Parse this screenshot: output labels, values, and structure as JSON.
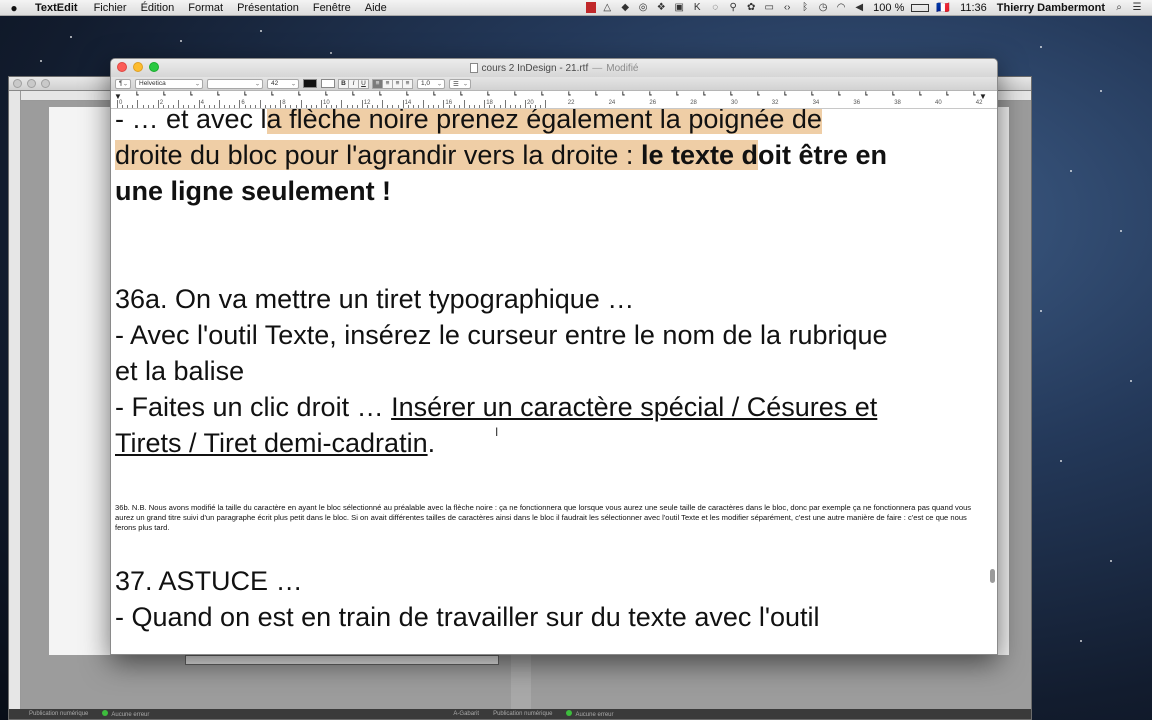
{
  "menubar": {
    "apple": "",
    "app_name": "TextEdit",
    "menus": [
      "Fichier",
      "Édition",
      "Format",
      "Présentation",
      "Fenêtre",
      "Aide"
    ],
    "battery": "100 %",
    "time": "11:36",
    "user": "Thierry Dambermont",
    "flag": "🇫🇷"
  },
  "window": {
    "title": "cours 2 InDesign - 21.rtf",
    "separator": "—",
    "status": "Modifié"
  },
  "toolbar": {
    "paragraph_style": "¶",
    "font_family": "Helvetica",
    "font_style": "",
    "font_size": "42",
    "bold_label": "B",
    "italic_label": "I",
    "underline_label": "U",
    "line_spacing": "1,0",
    "list_label": "☰"
  },
  "ruler": {
    "labels": [
      "0",
      "2",
      "4",
      "6",
      "8",
      "10",
      "12",
      "14",
      "16",
      "18",
      "20",
      "22",
      "24",
      "26",
      "28",
      "30",
      "32",
      "34",
      "36",
      "38",
      "40",
      "42"
    ]
  },
  "document": {
    "line1_a": "- … et avec l",
    "line1_b": "a flèche noire prenez également la poignée de",
    "line2_a": "droite du bloc pour l'agrandir vers la droite : ",
    "line2_b": "le texte d",
    "line2_c": "oit être en",
    "line3": "une ligne seulement !",
    "line4": "36a. On va mettre un tiret typographique …",
    "line5": "- Avec l'outil Texte, insérez le curseur entre le nom de la rubrique",
    "line6": "et la balise",
    "line7_a": "- Faites un clic droit … ",
    "line7_b": "Insérer un caractère spécial / Césures et",
    "line8_a": "Tirets / Tiret demi-cadratin",
    "line8_b": ".",
    "small_paragraph": "36b. N.B. Nous avons modifié la taille du caractère en ayant le bloc sélectionné au préalable avec la flèche noire : ça ne fonctionnera que lorsque vous aurez une seule taille de caractères dans le bloc, donc par exemple ça ne fonctionnera pas quand vous aurez un grand titre suivi d'un paragraphe écrit plus petit dans le bloc. Si on avait différentes tailles de caractères ainsi dans le bloc il faudrait les sélectionner avec l'outil Texte et les modifier séparément, c'est une autre manière de faire : c'est ce que nous ferons plus tard.",
    "line9": "37. ASTUCE …",
    "line10": "- Quand on est en train de travailler sur du texte avec l'outil"
  },
  "bg_window": {
    "status_left": "Publication numérique",
    "status_ok": "Aucune erreur",
    "status_right_a": "A-Gabarit",
    "status_right_b": "Publication numérique",
    "status_right_ok": "Aucune erreur"
  },
  "colors": {
    "highlight": "#efcea6",
    "close": "#fc5d57",
    "minimize": "#fdbc2e",
    "zoom": "#29c941"
  }
}
